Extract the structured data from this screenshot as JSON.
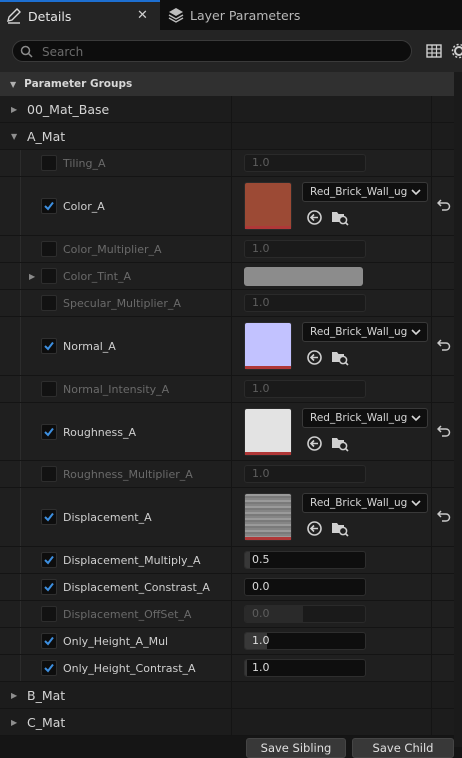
{
  "tabs": {
    "details": "Details",
    "layer_parameters": "Layer Parameters"
  },
  "search": {
    "placeholder": "Search"
  },
  "category": {
    "label": "Parameter Groups"
  },
  "groups": {
    "g0": "00_Mat_Base",
    "g1": "A_Mat",
    "g2": "B_Mat",
    "g3": "C_Mat"
  },
  "params": {
    "tiling": {
      "label": "Tiling_A",
      "value": "1.0",
      "enabled": false
    },
    "color": {
      "label": "Color_A",
      "asset": "Red_Brick_Wall_ug",
      "enabled": true,
      "swatch_color": "#9c4a35"
    },
    "color_multiplier": {
      "label": "Color_Multiplier_A",
      "value": "1.0",
      "enabled": false
    },
    "color_tint": {
      "label": "Color_Tint_A",
      "enabled": false,
      "tint_color": "#8c8c8c"
    },
    "specular_multiplier": {
      "label": "Specular_Multiplier_A",
      "value": "1.0",
      "enabled": false
    },
    "normal": {
      "label": "Normal_A",
      "asset": "Red_Brick_Wall_ug",
      "enabled": true,
      "swatch_color": "#c2c2ff"
    },
    "normal_intensity": {
      "label": "Normal_Intensity_A",
      "value": "1.0",
      "enabled": false
    },
    "roughness": {
      "label": "Roughness_A",
      "asset": "Red_Brick_Wall_ug",
      "enabled": true,
      "swatch_color": "#e3e3e3"
    },
    "roughness_multiplier": {
      "label": "Roughness_Multiplier_A",
      "value": "1.0",
      "enabled": false
    },
    "displacement": {
      "label": "Displacement_A",
      "asset": "Red_Brick_Wall_ug",
      "enabled": true,
      "swatch_color": "#8a8a8a"
    },
    "disp_multiply": {
      "label": "Displacement_Multiply_A",
      "value": "0.5",
      "enabled": true,
      "fill": 0.04
    },
    "disp_constrast": {
      "label": "Displacement_Constrast_A",
      "value": "0.0",
      "enabled": true,
      "fill": 0
    },
    "disp_offset": {
      "label": "Displacement_OffSet_A",
      "value": "0.0",
      "enabled": false,
      "fill": 0.48
    },
    "height_mul": {
      "label": "Only_Height_A_Mul",
      "value": "1.0",
      "enabled": true,
      "fill": 0.18
    },
    "height_contrast": {
      "label": "Only_Height_Contrast_A",
      "value": "1.0",
      "enabled": true,
      "fill": 0.02
    }
  },
  "buttons": {
    "save_sibling": "Save Sibling",
    "save_child": "Save Child"
  },
  "colors": {
    "accent": "#1d6fd1",
    "checkbox_check": "#3d8fe0",
    "texture_bar": "#b03838"
  }
}
